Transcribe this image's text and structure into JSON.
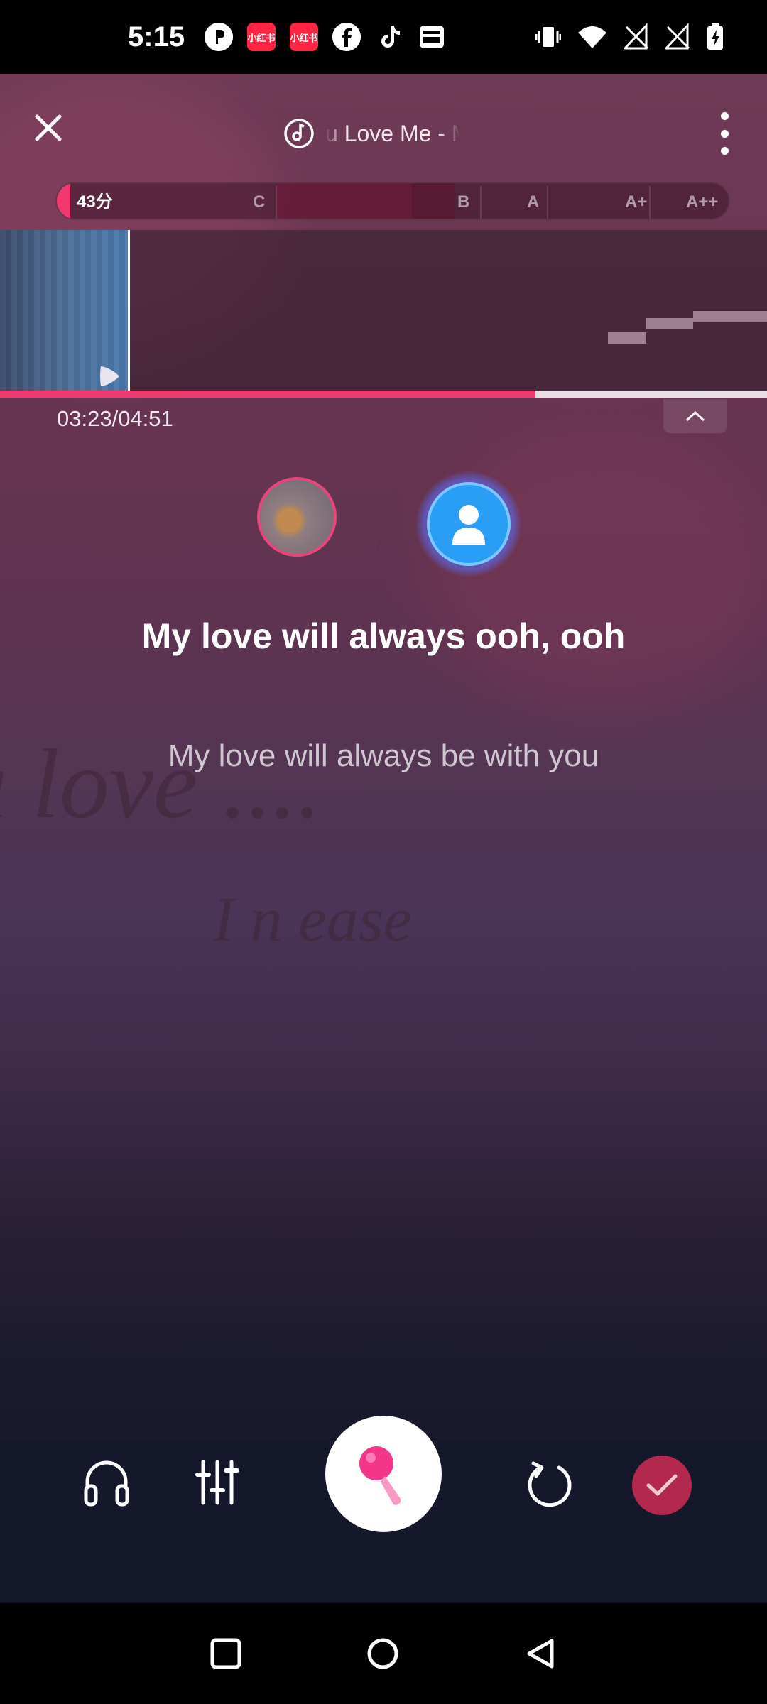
{
  "status_bar": {
    "time": "5:15",
    "app_icons": [
      "pinterest-icon",
      "xiaohongshu-icon",
      "xiaohongshu-icon",
      "facebook-icon",
      "tiktok-icon",
      "news-icon"
    ],
    "xiaohongshu_label": "小红书",
    "system_icons": [
      "vibrate-icon",
      "wifi-icon",
      "no-signal-icon",
      "no-signal-icon",
      "battery-charging-icon"
    ]
  },
  "header": {
    "song_title": "u Love Me - Ma",
    "close_icon": "close-icon",
    "menu_icon": "more-vert-icon",
    "music_icon": "music-disc-icon"
  },
  "score": {
    "value_label": "43分",
    "fill_fraction": 0.02,
    "grades": [
      "C",
      "B",
      "A",
      "A+",
      "A++"
    ]
  },
  "playback": {
    "current": "03:23",
    "total": "04:51",
    "time_text": "03:23/04:51",
    "progress_fraction": 0.698
  },
  "lyrics": {
    "current": "My love will always ooh, ooh",
    "next": "My love will always be with you"
  },
  "controls": {
    "headphones_icon": "headphones-icon",
    "mixer_icon": "mixer-sliders-icon",
    "mic_icon": "microphone-icon",
    "restart_icon": "restart-icon",
    "finish_icon": "check-icon"
  },
  "colors": {
    "accent": "#f0386e",
    "finish_button": "#b3284f",
    "avatar_blue": "#2a9df4",
    "controls_bg": "#15172a"
  }
}
